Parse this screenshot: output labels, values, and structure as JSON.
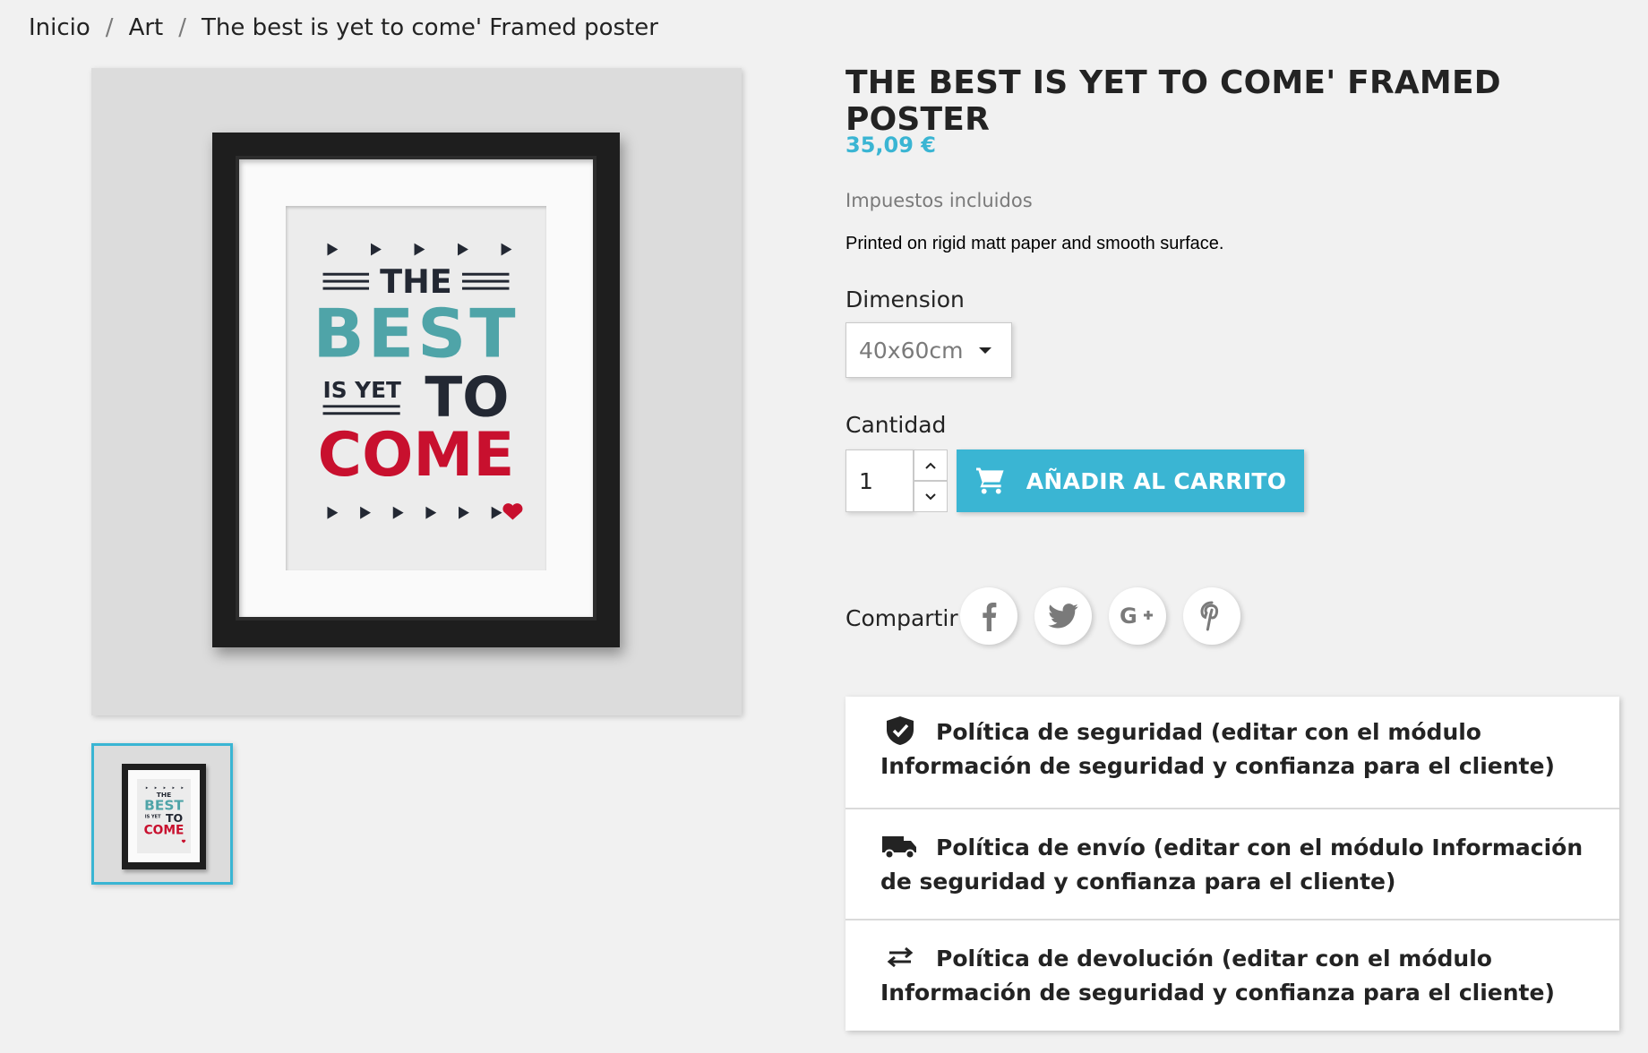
{
  "breadcrumb": {
    "items": [
      "Inicio",
      "Art",
      "The best is yet to come' Framed poster"
    ],
    "separator": "/"
  },
  "poster": {
    "line1": "THE",
    "line2": "BEST",
    "line3": "IS YET",
    "line4": "TO",
    "line5": "COME",
    "colors": {
      "dark": "#232833",
      "teal": "#4fa4a8",
      "red": "#c8102e"
    }
  },
  "product": {
    "title": "THE BEST IS YET TO COME' FRAMED POSTER",
    "price": "35,09 €",
    "tax_note": "Impuestos incluidos",
    "description": "Printed on rigid matt paper and smooth surface."
  },
  "variant": {
    "label": "Dimension",
    "selected": "40x60cm"
  },
  "quantity": {
    "label": "Cantidad",
    "value": "1"
  },
  "cart": {
    "button_label": "AÑADIR AL CARRITO",
    "icon": "shopping-cart-icon"
  },
  "share": {
    "label": "Compartir",
    "networks": [
      "facebook",
      "twitter",
      "google-plus",
      "pinterest"
    ]
  },
  "reassurance": [
    {
      "icon": "shield-check-icon",
      "text": "Política de seguridad (editar con el módulo Información de seguridad y confianza para el cliente)"
    },
    {
      "icon": "truck-icon",
      "text": "Política de envío (editar con el módulo Información de seguridad y confianza para el cliente)"
    },
    {
      "icon": "swap-arrows-icon",
      "text": "Política de devolución (editar con el módulo Información de seguridad y confianza para el cliente)"
    }
  ],
  "theme": {
    "accent": "#3ab5d3",
    "background": "#f1f1f1",
    "text": "#232323"
  }
}
